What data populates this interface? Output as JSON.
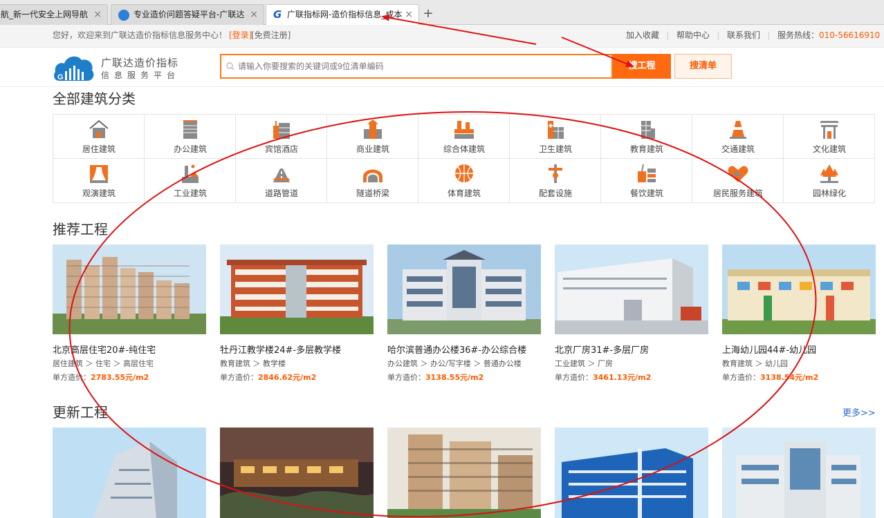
{
  "browser": {
    "tabs": [
      {
        "label": "航_新一代安全上网导航",
        "close": "×"
      },
      {
        "label": "专业造价问题答疑平台-广联达",
        "close": "×"
      },
      {
        "label": "广联指标网-造价指标信息_成本",
        "close": "×"
      }
    ],
    "new_tab": "+"
  },
  "topbar": {
    "welcome": "您好，欢迎来到广联达造价指标信息服务中心！",
    "login": "[登录]",
    "register": "[免费注册]",
    "links": [
      "加入收藏",
      "帮助中心",
      "联系我们"
    ],
    "hotline_label": "服务热线：",
    "hotline": "010-56616910"
  },
  "header": {
    "logo_line1": "广联达造价指标",
    "logo_line2": "信息服务平台",
    "search_placeholder": "请输入你要搜索的关键词或9位清单编码",
    "btn_project": "搜工程",
    "btn_list": "搜清单"
  },
  "categories": {
    "title": "全部建筑分类",
    "items": [
      {
        "label": "居住建筑",
        "icon": "house-icon"
      },
      {
        "label": "办公建筑",
        "icon": "office-icon"
      },
      {
        "label": "宾馆酒店",
        "icon": "hotel-icon"
      },
      {
        "label": "商业建筑",
        "icon": "commercial-icon"
      },
      {
        "label": "综合体建筑",
        "icon": "complex-icon"
      },
      {
        "label": "卫生建筑",
        "icon": "hospital-icon"
      },
      {
        "label": "教育建筑",
        "icon": "school-icon"
      },
      {
        "label": "交通建筑",
        "icon": "traffic-cone-icon"
      },
      {
        "label": "文化建筑",
        "icon": "culture-gate-icon"
      },
      {
        "label": "观演建筑",
        "icon": "theater-icon"
      },
      {
        "label": "工业建筑",
        "icon": "factory-icon"
      },
      {
        "label": "道路管道",
        "icon": "road-icon"
      },
      {
        "label": "隧道桥梁",
        "icon": "tunnel-bridge-icon"
      },
      {
        "label": "体育建筑",
        "icon": "ball-icon"
      },
      {
        "label": "配套设施",
        "icon": "facility-icon"
      },
      {
        "label": "餐饮建筑",
        "icon": "dining-icon"
      },
      {
        "label": "居民服务建筑",
        "icon": "handshake-icon"
      },
      {
        "label": "园林绿化",
        "icon": "tree-icon"
      }
    ]
  },
  "recommended": {
    "title": "推荐工程",
    "items": [
      {
        "title": "北京高层住宅20#-纯住宅",
        "crumb": "居住建筑 ＞ 住宅 ＞ 高层住宅",
        "price_label": "单方造价：",
        "price": "2783.55元/m2"
      },
      {
        "title": "牡丹江教学楼24#-多层教学楼",
        "crumb": "教育建筑 ＞ 教学楼",
        "price_label": "单方造价：",
        "price": "2846.62元/m2"
      },
      {
        "title": "哈尔滨普通办公楼36#-办公综合楼",
        "crumb": "办公建筑 ＞ 办公/写字楼 ＞ 普通办公楼",
        "price_label": "单方造价：",
        "price": "3138.55元/m2"
      },
      {
        "title": "北京厂房31#-多层厂房",
        "crumb": "工业建筑 ＞ 厂房",
        "price_label": "单方造价：",
        "price": "3461.13元/m2"
      },
      {
        "title": "上海幼儿园44#-幼儿园",
        "crumb": "教育建筑 ＞ 幼儿园",
        "price_label": "单方造价：",
        "price": "3138.54元/m2"
      }
    ]
  },
  "updated": {
    "title": "更新工程",
    "more": "更多>>"
  },
  "colors": {
    "accent": "#ff6a10",
    "link": "#2b6bd1",
    "annotation": "#dd1111"
  }
}
